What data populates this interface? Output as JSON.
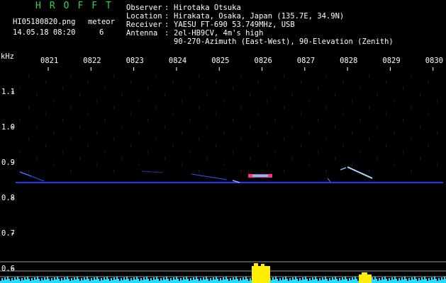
{
  "header": {
    "brand": "HROFFT",
    "filename": "HI05180820.png",
    "timestamp": "14.05.18 08:20",
    "meteor_label": "meteor",
    "meteor_count": "6"
  },
  "station": {
    "rows": [
      {
        "key": "Observer",
        "value": "Hirotaka Otsuka"
      },
      {
        "key": "Location",
        "value": "Hirakata, Osaka, Japan (135.7E, 34.9N)"
      },
      {
        "key": "Receiver",
        "value": "YAESU FT-690 53.749MHz, USB"
      },
      {
        "key": "Antenna",
        "value": "2el-HB9CV, 4m's high"
      }
    ],
    "antenna_line2": "90-270-Azimuth (East-West), 90-Elevation (Zenith)"
  },
  "axis": {
    "unit_label": "kHz",
    "time_ticks": [
      "0821",
      "0822",
      "0823",
      "0824",
      "0825",
      "0826",
      "0827",
      "0828",
      "0829",
      "0830"
    ],
    "freq_ticks": [
      "1.1",
      "1.0",
      "0.9",
      "0.8",
      "0.7",
      "0.6"
    ]
  },
  "colors": {
    "background": "#000000",
    "brand": "#2fd24a",
    "text": "#ffffff",
    "label_yellow": "#ffff66",
    "baseline": "#2233ff",
    "echo": "#66bbff",
    "burst": "#ffee00",
    "noise": "#22ddff"
  }
}
